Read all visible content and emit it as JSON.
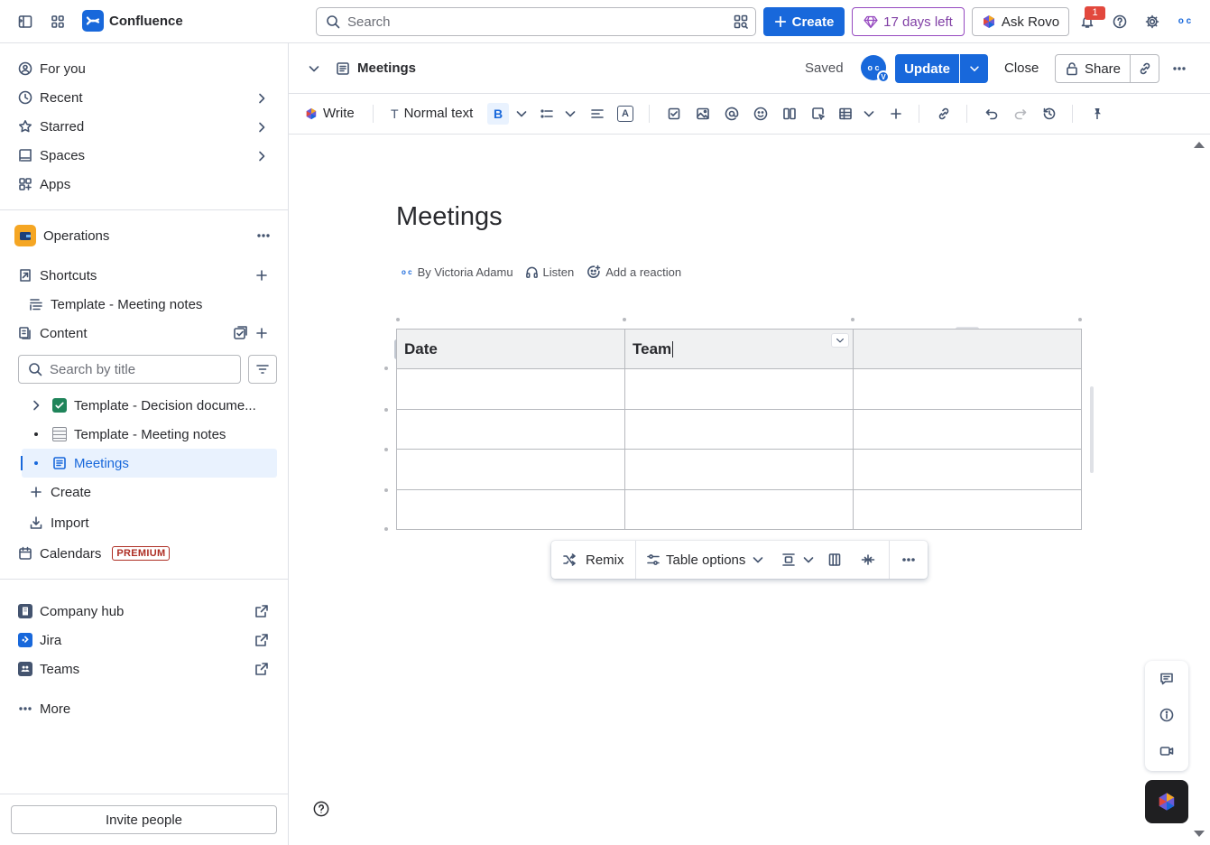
{
  "app": {
    "name": "Confluence"
  },
  "topbar": {
    "search_placeholder": "Search",
    "create_label": "Create",
    "trial_label": "17 days left",
    "rovo_label": "Ask Rovo",
    "notification_count": "1",
    "avatar_initials": "o c"
  },
  "sidebar": {
    "nav": [
      {
        "label": "For you",
        "icon": "user-circle-icon"
      },
      {
        "label": "Recent",
        "icon": "clock-icon"
      },
      {
        "label": "Starred",
        "icon": "star-icon"
      },
      {
        "label": "Spaces",
        "icon": "spaces-icon"
      },
      {
        "label": "Apps",
        "icon": "apps-icon"
      }
    ],
    "space_name": "Operations",
    "shortcuts_label": "Shortcuts",
    "shortcut_item": "Template - Meeting notes",
    "content_label": "Content",
    "search_placeholder": "Search by title",
    "tree": [
      {
        "label": "Template - Decision docume...",
        "emoji": "✅"
      },
      {
        "label": "Template - Meeting notes",
        "emoji": "🗒️"
      },
      {
        "label": "Meetings",
        "selected": true
      }
    ],
    "create_label": "Create",
    "import_label": "Import",
    "calendars_label": "Calendars",
    "premium_label": "PREMIUM",
    "apps": [
      {
        "label": "Company hub"
      },
      {
        "label": "Jira"
      },
      {
        "label": "Teams"
      }
    ],
    "more_label": "More",
    "invite_label": "Invite people"
  },
  "page_header": {
    "title": "Meetings",
    "saved_label": "Saved",
    "avatar_initials": "o c",
    "avatar_badge": "V",
    "update_label": "Update",
    "close_label": "Close",
    "share_label": "Share"
  },
  "editor_toolbar": {
    "write_label": "Write",
    "text_style_label": "Normal text",
    "bold_label": "B",
    "text_color_label": "A"
  },
  "document": {
    "title": "Meetings",
    "author_avatar": "o c",
    "byline": "By Victoria Adamu",
    "listen_label": "Listen",
    "reaction_label": "Add a reaction",
    "table": {
      "headers": [
        "Date",
        "Team",
        ""
      ],
      "rows": [
        [
          "",
          "",
          ""
        ],
        [
          "",
          "",
          ""
        ],
        [
          "",
          "",
          ""
        ],
        [
          "",
          "",
          ""
        ]
      ]
    }
  },
  "table_toolbar": {
    "remix_label": "Remix",
    "options_label": "Table options"
  },
  "colors": {
    "brand": "#1868db",
    "trial": "#803fa5",
    "badge": "#e2483d",
    "selected_bg": "#e9f2fe"
  }
}
